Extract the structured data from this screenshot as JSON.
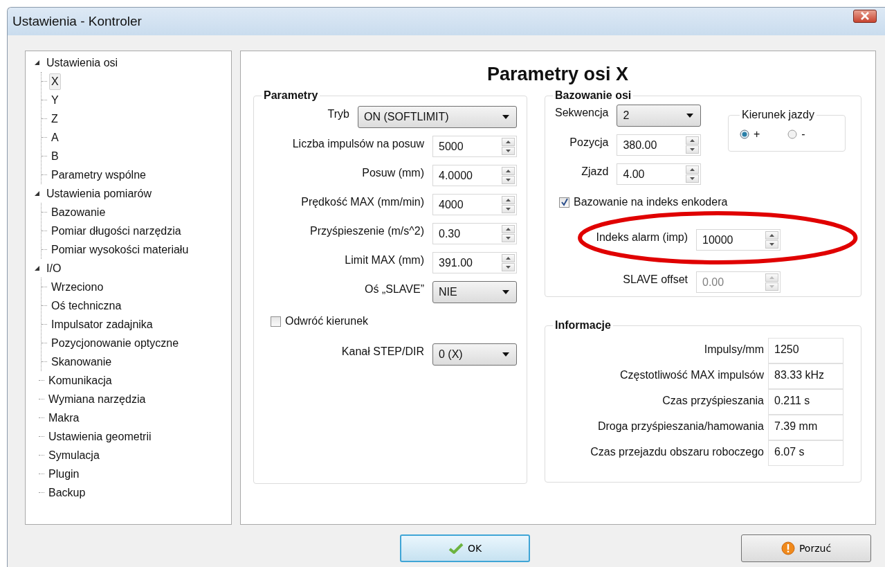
{
  "window": {
    "title": "Ustawienia - Kontroler"
  },
  "tree": [
    {
      "label": "Ustawienia osi",
      "expanded": true,
      "selected": false,
      "children": [
        {
          "label": "X",
          "selected": true
        },
        {
          "label": "Y",
          "selected": false
        },
        {
          "label": "Z",
          "selected": false
        },
        {
          "label": "A",
          "selected": false
        },
        {
          "label": "B",
          "selected": false
        },
        {
          "label": "Parametry wspólne",
          "selected": false
        }
      ]
    },
    {
      "label": "Ustawienia pomiarów",
      "expanded": true,
      "selected": false,
      "children": [
        {
          "label": "Bazowanie",
          "selected": false
        },
        {
          "label": "Pomiar długości narzędzia",
          "selected": false
        },
        {
          "label": "Pomiar wysokości materiału",
          "selected": false
        }
      ]
    },
    {
      "label": "I/O",
      "expanded": true,
      "selected": false,
      "children": [
        {
          "label": "Wrzeciono",
          "selected": false
        },
        {
          "label": "Oś techniczna",
          "selected": false
        },
        {
          "label": "Impulsator zadajnika",
          "selected": false
        },
        {
          "label": "Pozycjonowanie optyczne",
          "selected": false
        },
        {
          "label": "Skanowanie",
          "selected": false
        }
      ]
    },
    {
      "label": "Komunikacja",
      "selected": false
    },
    {
      "label": "Wymiana narzędzia",
      "selected": false
    },
    {
      "label": "Makra",
      "selected": false
    },
    {
      "label": "Ustawienia geometrii",
      "selected": false
    },
    {
      "label": "Symulacja",
      "selected": false
    },
    {
      "label": "Plugin",
      "selected": false
    },
    {
      "label": "Backup",
      "selected": false
    }
  ],
  "heading": "Parametry osi X",
  "parametry": {
    "title": "Parametry",
    "rows": [
      {
        "kind": "select",
        "label": "Tryb",
        "value": "ON (SOFTLIMIT)"
      },
      {
        "kind": "spin",
        "label": "Liczba impulsów na posuw",
        "value": "5000"
      },
      {
        "kind": "spin",
        "label": "Posuw (mm)",
        "value": "4.0000"
      },
      {
        "kind": "spin",
        "label": "Prędkość MAX (mm/min)",
        "value": "4000"
      },
      {
        "kind": "spin",
        "label": "Przyśpieszenie (m/s^2)",
        "value": "0.30"
      },
      {
        "kind": "spin",
        "label": "Limit MAX (mm)",
        "value": "391.00"
      },
      {
        "kind": "select",
        "label": "Oś „SLAVE”",
        "value": "NIE"
      },
      {
        "kind": "checkbox",
        "label": "Odwróć kierunek",
        "checked": false
      },
      {
        "kind": "select",
        "label": "Kanał STEP/DIR",
        "value": "0 (X)"
      }
    ]
  },
  "bazowanie": {
    "title": "Bazowanie osi",
    "rows": [
      {
        "kind": "select",
        "label": "Sekwencja",
        "value": "2"
      },
      {
        "kind": "spin",
        "label": "Pozycja",
        "value": "380.00"
      },
      {
        "kind": "spin",
        "label": "Zjazd",
        "value": "4.00"
      }
    ],
    "direction": {
      "title": "Kierunek jazdy",
      "options": [
        {
          "label": "+",
          "selected": true
        },
        {
          "label": "-",
          "selected": false
        }
      ]
    },
    "encoder_checkbox": {
      "label": "Bazowanie na indeks enkodera",
      "checked": true
    },
    "extra_rows": [
      {
        "kind": "spin",
        "label": "Indeks alarm (imp)",
        "value": "10000",
        "disabled": false,
        "highlighted": true
      },
      {
        "kind": "spin",
        "label": "SLAVE offset",
        "value": "0.00",
        "disabled": true,
        "highlighted": false
      }
    ]
  },
  "informacje": {
    "title": "Informacje",
    "rows": [
      {
        "label": "Impulsy/mm",
        "value": "1250"
      },
      {
        "label": "Częstotliwość MAX impulsów",
        "value": "83.33 kHz"
      },
      {
        "label": "Czas przyśpieszania",
        "value": "0.211 s"
      },
      {
        "label": "Droga przyśpieszania/hamowania",
        "value": "7.39 mm"
      },
      {
        "label": "Czas przejazdu obszaru roboczego",
        "value": "6.07 s"
      }
    ]
  },
  "buttons": [
    {
      "kind": "ok",
      "label": "OK"
    },
    {
      "kind": "cancel",
      "label": "Porzuć"
    }
  ]
}
